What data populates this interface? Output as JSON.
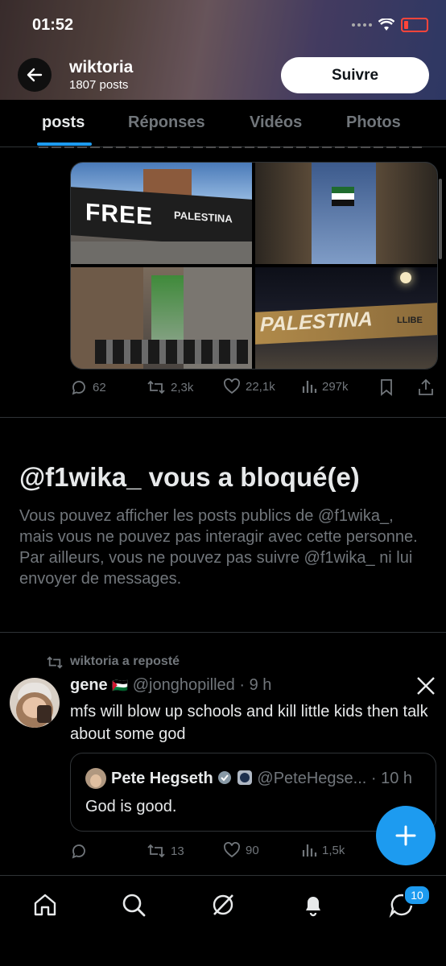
{
  "status_bar": {
    "time": "01:52"
  },
  "profile": {
    "name": "wiktoria",
    "posts_count": "1807 posts",
    "follow_label": "Suivre"
  },
  "tabs": [
    {
      "label": "posts",
      "active": true
    },
    {
      "label": "Réponses",
      "active": false
    },
    {
      "label": "Vidéos",
      "active": false
    },
    {
      "label": "Photos",
      "active": false
    }
  ],
  "post1": {
    "media_texts": {
      "mural_1": "FREE",
      "mural_1b": "PALESTINA",
      "mural_2": "PALESTINA",
      "mural_2b": "LLIBE"
    },
    "actions": {
      "replies": "62",
      "reposts": "2,3k",
      "likes": "22,1k",
      "views": "297k"
    }
  },
  "blocked": {
    "title": "@f1wika_ vous a bloqué(e)",
    "body": "Vous pouvez afficher les posts publics de @f1wika_, mais vous ne pouvez pas interagir avec cette personne. Par ailleurs, vous ne pouvez pas suivre @f1wika_ ni lui envoyer de messages."
  },
  "post2": {
    "repost_label": "wiktoria a reposté",
    "author_name": "gene",
    "author_flag": "🇵🇸",
    "handle_time": "@jonghopilled · 9 h",
    "text": "mfs will blow up schools and kill little kids then talk about some god",
    "quote": {
      "author_name": "Pete Hegseth",
      "handle_time": "@PeteHegse... · 10 h",
      "text": "God is good."
    },
    "actions": {
      "replies": "",
      "reposts": "13",
      "likes": "90",
      "views": "1,5k"
    }
  },
  "bottom_nav": {
    "messages_badge": "10"
  },
  "colors": {
    "accent": "#1d9bf0",
    "background": "#000000",
    "muted": "#71767b",
    "text": "#e7e9ea"
  }
}
